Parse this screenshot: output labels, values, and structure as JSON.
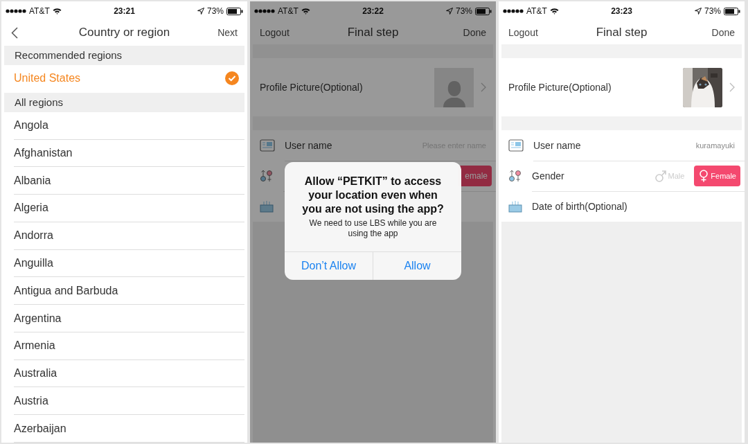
{
  "screens": [
    {
      "kind": "region_list",
      "status_bar": {
        "carrier": "AT&T",
        "time": "23:21",
        "battery": "73%"
      },
      "nav": {
        "title": "Country or region",
        "right": "Next"
      },
      "sections": [
        {
          "header": "Recommended regions",
          "items": [
            {
              "name": "United States",
              "selected": true
            }
          ]
        },
        {
          "header": "All regions",
          "items": [
            {
              "name": "Angola",
              "selected": false
            },
            {
              "name": "Afghanistan",
              "selected": false
            },
            {
              "name": "Albania",
              "selected": false
            },
            {
              "name": "Algeria",
              "selected": false
            },
            {
              "name": "Andorra",
              "selected": false
            },
            {
              "name": "Anguilla",
              "selected": false
            },
            {
              "name": "Antigua and Barbuda",
              "selected": false
            },
            {
              "name": "Argentina",
              "selected": false
            },
            {
              "name": "Armenia",
              "selected": false
            },
            {
              "name": "Australia",
              "selected": false
            },
            {
              "name": "Austria",
              "selected": false
            },
            {
              "name": "Azerbaijan",
              "selected": false
            }
          ]
        }
      ]
    },
    {
      "kind": "profile_form",
      "status_bar": {
        "carrier": "AT&T",
        "time": "23:22",
        "battery": "73%"
      },
      "nav": {
        "left": "Logout",
        "title": "Final step",
        "right": "Done"
      },
      "profile": {
        "label": "Profile Picture(Optional)"
      },
      "username": {
        "label": "User name",
        "placeholder": "Please enter name"
      },
      "gender": {
        "options": [
          {
            "label": "emale",
            "selected": true
          }
        ]
      },
      "alert": {
        "title": "Allow “PETKIT” to access your location even when you are not using the app?",
        "message": "We need to use LBS while you are using the app",
        "buttons": [
          "Don’t Allow",
          "Allow"
        ]
      }
    },
    {
      "kind": "profile_form",
      "status_bar": {
        "carrier": "AT&T",
        "time": "23:23",
        "battery": "73%"
      },
      "nav": {
        "left": "Logout",
        "title": "Final step",
        "right": "Done"
      },
      "profile": {
        "label": "Profile Picture(Optional)"
      },
      "username": {
        "label": "User name",
        "value": "kuramayuki"
      },
      "gender": {
        "label": "Gender",
        "options": [
          {
            "label": "Male",
            "selected": false
          },
          {
            "label": "Female",
            "selected": true
          }
        ]
      },
      "birth": {
        "label": "Date of birth(Optional)"
      }
    }
  ]
}
